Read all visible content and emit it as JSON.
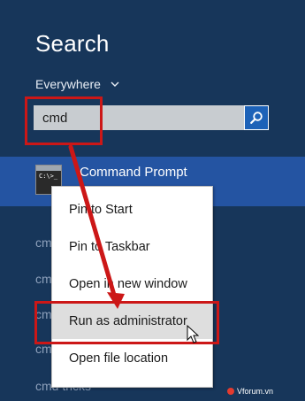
{
  "search": {
    "title": "Search",
    "scope_label": "Everywhere",
    "query": "cmd"
  },
  "result": {
    "label": "Command Prompt",
    "icon_text": "C:\\>_"
  },
  "suggestions": [
    "cmd",
    "cmd",
    "cmd",
    "cmd",
    "cmd",
    "cmd tricks"
  ],
  "context_menu": {
    "items": [
      {
        "label": "Pin to Start"
      },
      {
        "label": "Pin to Taskbar"
      },
      {
        "label": "Open in new window"
      },
      {
        "label": "Run as administrator",
        "hovered": true
      },
      {
        "label": "Open file location"
      }
    ]
  },
  "watermark": "Vforum.vn",
  "colors": {
    "background": "#17365a",
    "result_highlight": "#2454a2",
    "search_button": "#1d62b8",
    "annotation_red": "#cc1717",
    "menu_hover": "#dedede"
  }
}
